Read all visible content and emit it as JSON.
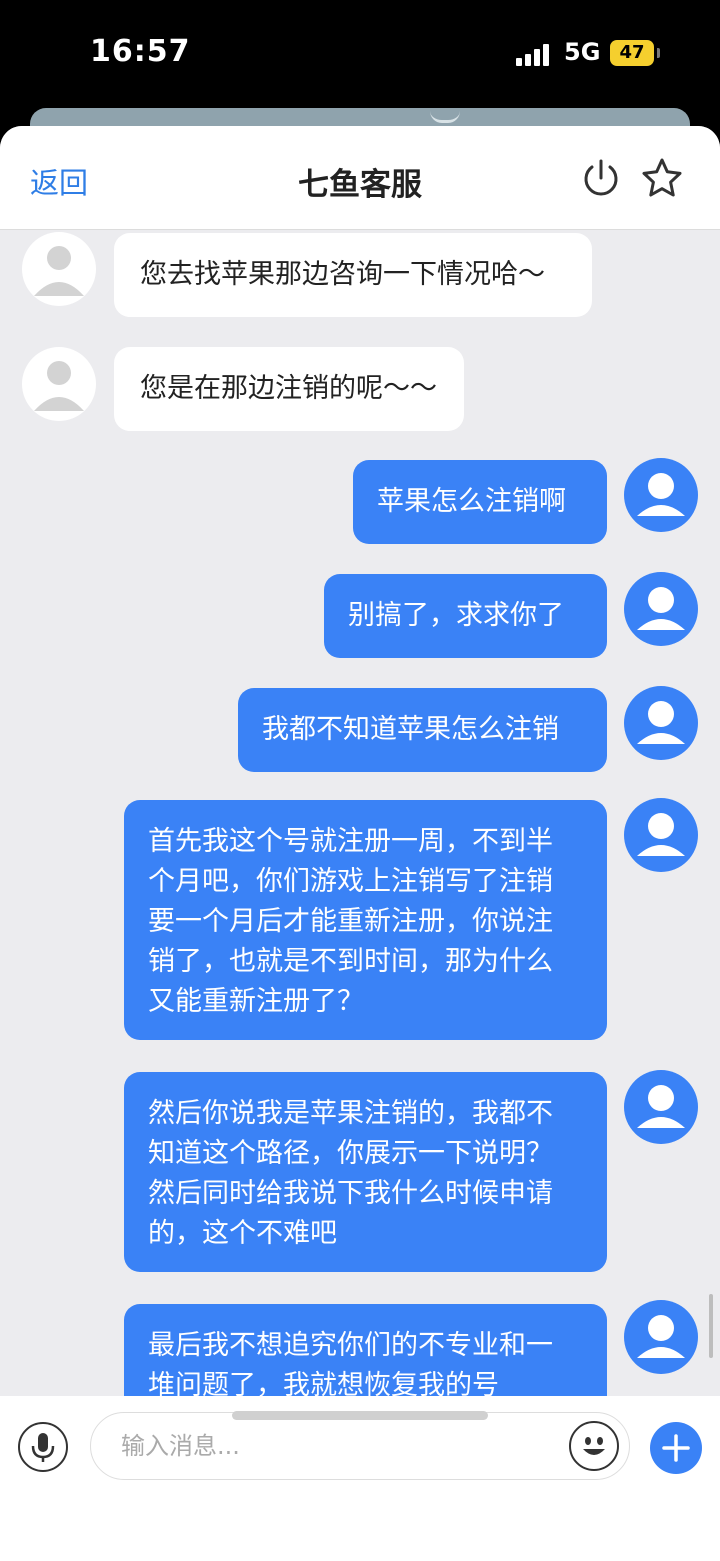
{
  "status_bar": {
    "time": "16:57",
    "network": "5G",
    "battery": "47"
  },
  "header": {
    "back_label": "返回",
    "title": "七鱼客服"
  },
  "messages": [
    {
      "from": "agent",
      "text": "您去找苹果那边咨询一下情况哈～"
    },
    {
      "from": "agent",
      "text": "您是在那边注销的呢～～"
    },
    {
      "from": "user",
      "text": "苹果怎么注销啊"
    },
    {
      "from": "user",
      "text": "别搞了，求求你了"
    },
    {
      "from": "user",
      "text": "我都不知道苹果怎么注销"
    },
    {
      "from": "user",
      "text": "首先我这个号就注册一周，不到半\n个月吧，你们游戏上注销写了注销\n要一个月后才能重新注册，你说注\n销了，也就是不到时间，那为什么\n又能重新注册了？"
    },
    {
      "from": "user",
      "text": "然后你说我是苹果注销的，我都不\n知道这个路径，你展示一下说明？\n然后同时给我说下我什么时候申请\n的，这个不难吧"
    },
    {
      "from": "user",
      "text": "最后我不想追究你们的不专业和一\n堆问题了，我就想恢复我的号"
    }
  ],
  "input": {
    "placeholder": "输入消息..."
  },
  "colors": {
    "accent": "#3a82f6",
    "link": "#2f7ee6",
    "battery": "#f5cf2e"
  },
  "icons": [
    "power-icon",
    "star-icon",
    "microphone-icon",
    "emoji-icon",
    "plus-icon",
    "user-avatar-icon"
  ]
}
